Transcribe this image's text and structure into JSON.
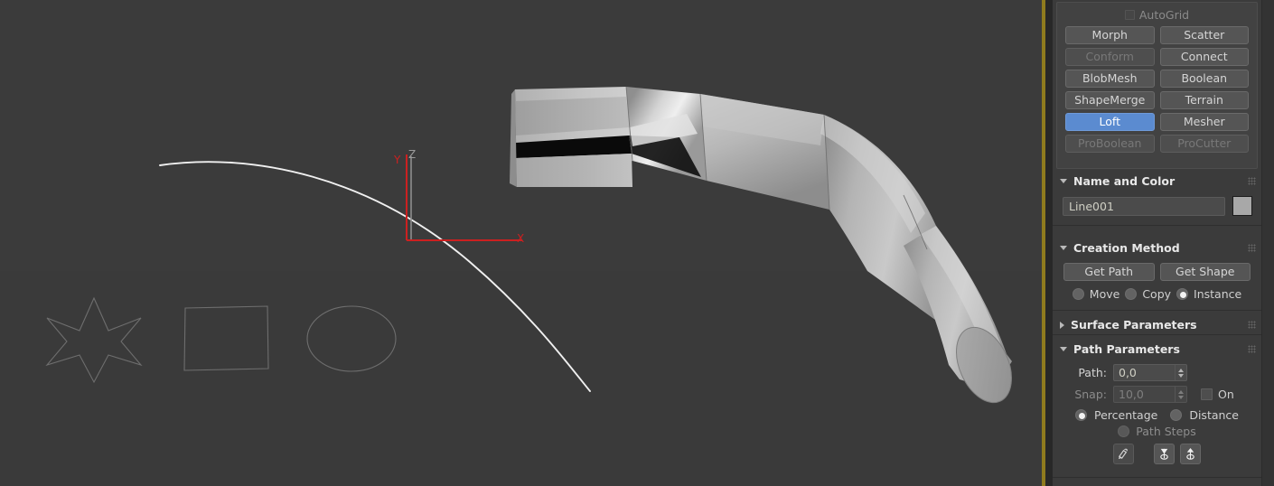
{
  "app": {
    "name": "3ds-max-loft-command-panel",
    "accent_blue": "#5b8bd0",
    "viewport_border_color": "#8f7b1e",
    "panel_bg": "#3b3b3b",
    "viewport_bg": "#3a3a3a"
  },
  "object_type": {
    "autogrid_label": "AutoGrid",
    "autogrid_checked": false,
    "buttons": [
      {
        "label": "Morph",
        "state": "normal"
      },
      {
        "label": "Scatter",
        "state": "normal"
      },
      {
        "label": "Conform",
        "state": "disabled"
      },
      {
        "label": "Connect",
        "state": "normal"
      },
      {
        "label": "BlobMesh",
        "state": "normal"
      },
      {
        "label": "Boolean",
        "state": "normal"
      },
      {
        "label": "ShapeMerge",
        "state": "normal"
      },
      {
        "label": "Terrain",
        "state": "normal"
      },
      {
        "label": "Loft",
        "state": "active"
      },
      {
        "label": "Mesher",
        "state": "normal"
      },
      {
        "label": "ProBoolean",
        "state": "disabled"
      },
      {
        "label": "ProCutter",
        "state": "disabled"
      }
    ]
  },
  "name_and_color": {
    "title": "Name and Color",
    "expanded": true,
    "object_name": "Line001",
    "color": "#a8a8a8"
  },
  "creation_method": {
    "title": "Creation Method",
    "expanded": true,
    "get_path_label": "Get Path",
    "get_shape_label": "Get Shape",
    "options": [
      {
        "label": "Move",
        "selected": false
      },
      {
        "label": "Copy",
        "selected": false
      },
      {
        "label": "Instance",
        "selected": true
      }
    ]
  },
  "surface_parameters": {
    "title": "Surface Parameters",
    "expanded": false
  },
  "path_parameters": {
    "title": "Path Parameters",
    "expanded": true,
    "path_label": "Path:",
    "path_value": "0,0",
    "snap_label": "Snap:",
    "snap_value": "10,0",
    "snap_enabled": false,
    "on_label": "On",
    "on_checked": false,
    "measure_options": [
      {
        "label": "Percentage",
        "selected": true,
        "disabled": false
      },
      {
        "label": "Distance",
        "selected": false,
        "disabled": false
      },
      {
        "label": "Path Steps",
        "selected": false,
        "disabled": true
      }
    ],
    "tool_buttons": [
      {
        "name": "pick-shape-icon",
        "pressed": false
      },
      {
        "name": "previous-shape-icon",
        "pressed": false
      },
      {
        "name": "next-shape-icon",
        "pressed": false
      }
    ]
  },
  "viewport": {
    "axis_tripod": {
      "x_label": "X",
      "y_label": "Y",
      "z_label": "Z",
      "x_color": "#cc2020",
      "y_color": "#cc2020",
      "z_color": "#8e8e8e"
    },
    "shapes": [
      {
        "name": "star-shape",
        "type": "star"
      },
      {
        "name": "rectangle-shape",
        "type": "rectangle"
      },
      {
        "name": "ellipse-shape",
        "type": "ellipse"
      }
    ],
    "path_line": {
      "name": "loft-path-spline",
      "color": "#f0f0f0"
    },
    "loft_object": {
      "name": "loft-mesh",
      "color": "#b9b9b9"
    }
  }
}
